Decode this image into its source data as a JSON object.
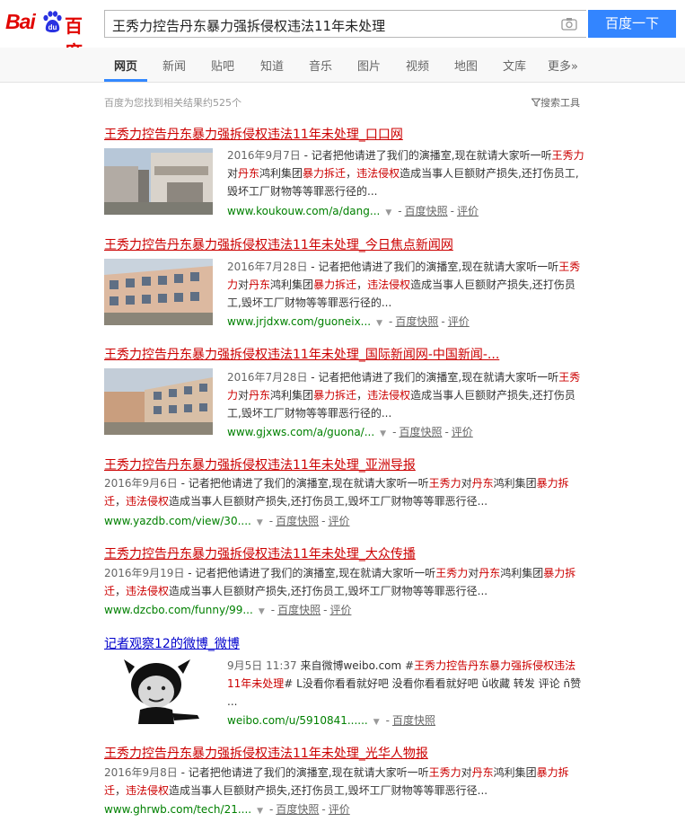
{
  "logo": {
    "text_bai": "Bai",
    "text_du": "du",
    "text_cn": "百度"
  },
  "search": {
    "query": "王秀力控告丹东暴力强拆侵权违法11年未处理",
    "button": "百度一下"
  },
  "nav": {
    "tabs": [
      "网页",
      "新闻",
      "贴吧",
      "知道",
      "音乐",
      "图片",
      "视频",
      "地图",
      "文库",
      "更多»"
    ],
    "active": "网页"
  },
  "result_count": "百度为您找到相关结果约525个",
  "tools_label": "搜索工具",
  "results": [
    {
      "title": "王秀力控告丹东暴力强拆侵权违法11年未处理_口口网",
      "date": "2016年9月7日",
      "snippet_parts": [
        " - 记者把他请进了我们的演播室,现在就请大家听一听",
        "王秀力",
        "对",
        "丹东",
        "鸿利集团",
        "暴力拆迁",
        "，",
        "违法侵权",
        "造成当事人巨额财产损失,还打伤员工,毁坏工厂财物等等罪恶行径的..."
      ],
      "url": "www.koukouw.com/a/dang...",
      "cache": "百度快照",
      "review": "评价"
    },
    {
      "title": "王秀力控告丹东暴力强拆侵权违法11年未处理_今日焦点新闻网",
      "date": "2016年7月28日",
      "snippet_parts": [
        " - 记者把他请进了我们的演播室,现在就请大家听一听",
        "王秀力",
        "对",
        "丹东",
        "鸿利集团",
        "暴力拆迁",
        "，",
        "违法侵权",
        "造成当事人巨额财产损失,还打伤员工,毁坏工厂财物等等罪恶行径的..."
      ],
      "url": "www.jrjdxw.com/guoneix...",
      "cache": "百度快照",
      "review": "评价"
    },
    {
      "title": "王秀力控告丹东暴力强拆侵权违法11年未处理_国际新闻网-中国新闻-...",
      "date": "2016年7月28日",
      "snippet_parts": [
        " - 记者把他请进了我们的演播室,现在就请大家听一听",
        "王秀力",
        "对",
        "丹东",
        "鸿利集团",
        "暴力拆迁",
        "，",
        "违法侵权",
        "造成当事人巨额财产损失,还打伤员工,毁坏工厂财物等等罪恶行径的..."
      ],
      "url": "www.gjxws.com/a/guona/...",
      "cache": "百度快照",
      "review": "评价"
    },
    {
      "title": "王秀力控告丹东暴力强拆侵权违法11年未处理_亚洲导报",
      "date": "2016年9月6日",
      "snippet_parts": [
        " - 记者把他请进了我们的演播室,现在就请大家听一听",
        "王秀力",
        "对",
        "丹东",
        "鸿利集团",
        "暴力拆迁",
        "，",
        "违法侵权",
        "造成当事人巨额财产损失,还打伤员工,毁坏工厂财物等等罪恶行径..."
      ],
      "url": "www.yazdb.com/view/30....",
      "cache": "百度快照",
      "review": "评价"
    },
    {
      "title": "王秀力控告丹东暴力强拆侵权违法11年未处理_大众传播",
      "date": "2016年9月19日",
      "snippet_parts": [
        " - 记者把他请进了我们的演播室,现在就请大家听一听",
        "王秀力",
        "对",
        "丹东",
        "鸿利集团",
        "暴力拆迁",
        "，",
        "违法侵权",
        "造成当事人巨额财产损失,还打伤员工,毁坏工厂财物等等罪恶行径..."
      ],
      "url": "www.dzcbo.com/funny/99...",
      "cache": "百度快照",
      "review": "评价"
    },
    {
      "title": "记者观察12的微博_微博",
      "date": "9月5日 11:37",
      "snippet_parts": [
        " 来自微博weibo.com #",
        "王秀力控告丹东暴力强拆侵权违法11年未处理",
        "# L没看你看看就好吧 没看你看看就好吧 ǔ收藏 转发 评论 ñ赞 ..."
      ],
      "url": "weibo.com/u/5910841......",
      "cache": "百度快照"
    },
    {
      "title": "王秀力控告丹东暴力强拆侵权违法11年未处理_光华人物报",
      "date": "2016年9月8日",
      "snippet_parts": [
        " - 记者把他请进了我们的演播室,现在就请大家听一听",
        "王秀力",
        "对",
        "丹东",
        "鸿利集团",
        "暴力拆迁",
        "，",
        "违法侵权",
        "造成当事人巨额财产损失,还打伤员工,毁坏工厂财物等等罪恶行径..."
      ],
      "url": "www.ghrwb.com/tech/21....",
      "cache": "百度快照",
      "review": "评价"
    }
  ],
  "colors": {
    "accent": "#3385ff",
    "title_red": "#cc0000",
    "url_green": "#008000"
  }
}
